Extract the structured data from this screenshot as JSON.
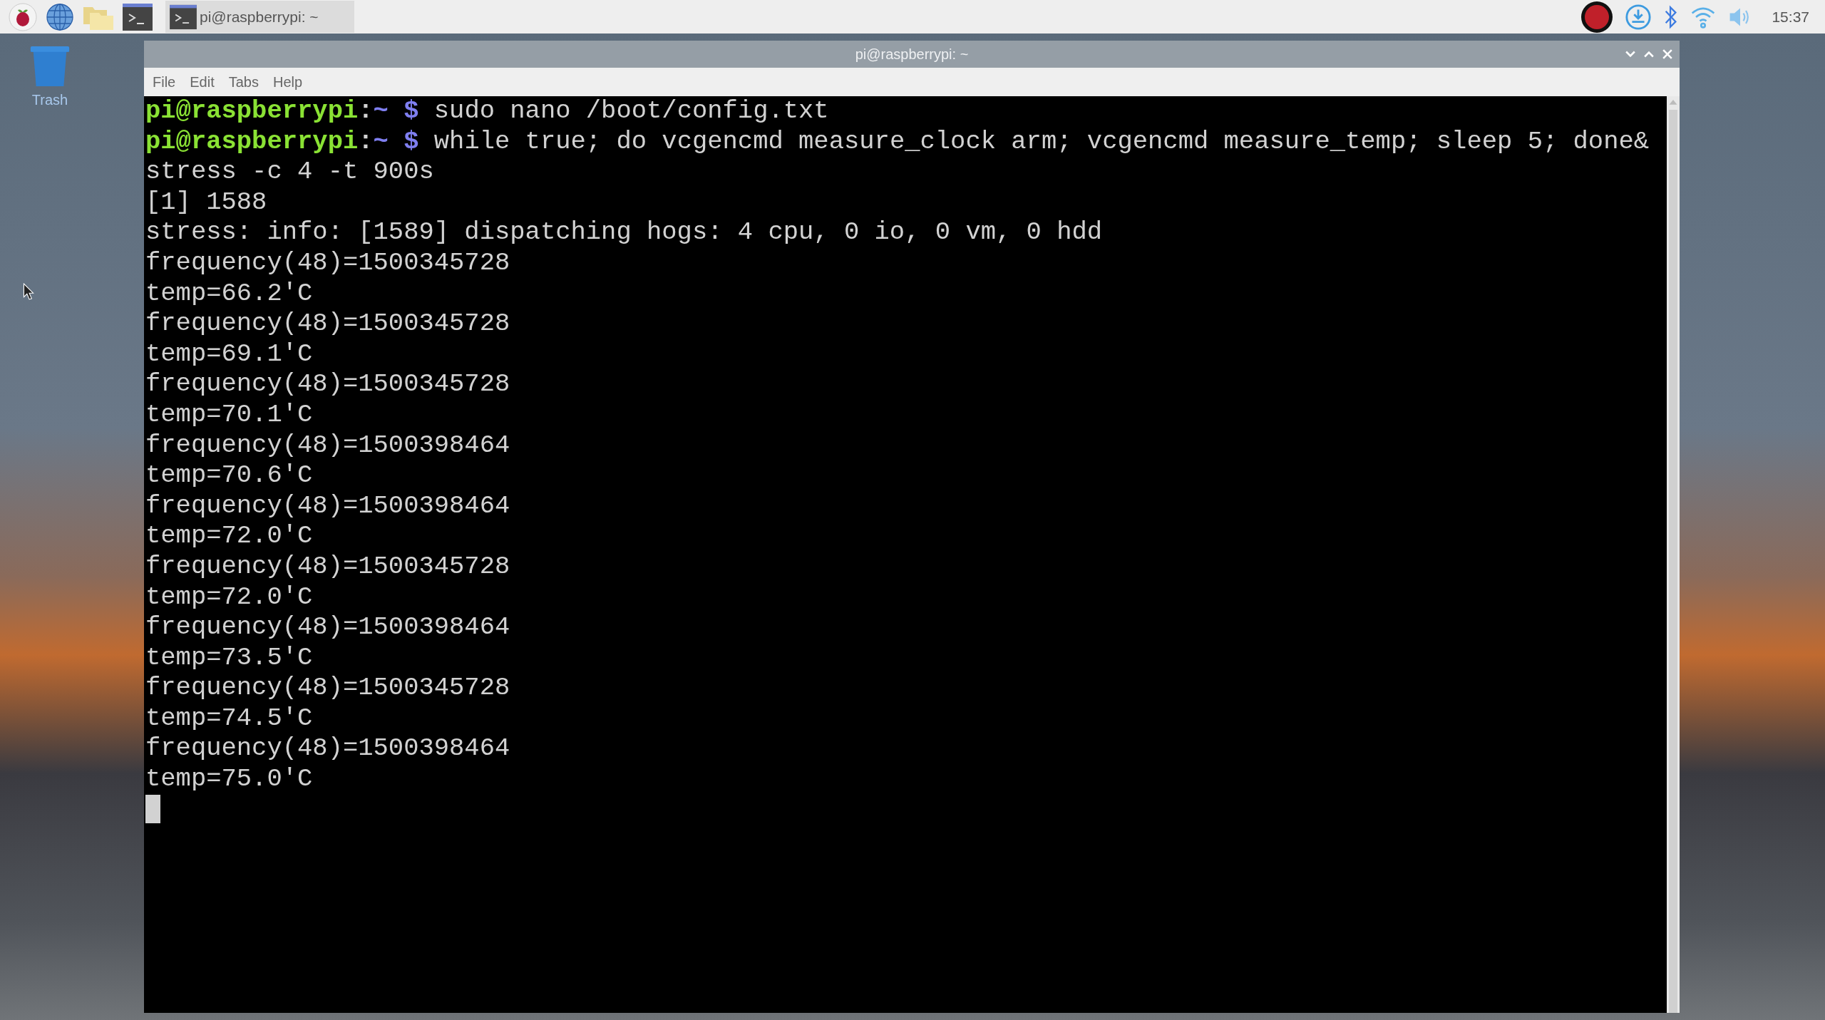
{
  "taskbar": {
    "task_button": {
      "title": "pi@raspberrypi: ~"
    },
    "clock": "15:37"
  },
  "desktop": {
    "icons": [
      {
        "label": "Trash"
      }
    ]
  },
  "window": {
    "title": "pi@raspberrypi: ~",
    "menu": [
      "File",
      "Edit",
      "Tabs",
      "Help"
    ],
    "terminal": {
      "lines": [
        {
          "kind": "prompt",
          "user_host": "pi@raspberrypi",
          "separator": ":",
          "path": "~",
          "symbol": "$",
          "command": "sudo nano /boot/config.txt"
        },
        {
          "kind": "prompt",
          "user_host": "pi@raspberrypi",
          "separator": ":",
          "path": "~",
          "symbol": "$",
          "command": "while true; do vcgencmd measure_clock arm; vcgencmd measure_temp; sleep 5; done&"
        },
        {
          "kind": "output",
          "text": "stress -c 4 -t 900s"
        },
        {
          "kind": "output",
          "text": "[1] 1588"
        },
        {
          "kind": "output",
          "text": "stress: info: [1589] dispatching hogs: 4 cpu, 0 io, 0 vm, 0 hdd"
        },
        {
          "kind": "output",
          "text": "frequency(48)=1500345728"
        },
        {
          "kind": "output",
          "text": "temp=66.2'C"
        },
        {
          "kind": "output",
          "text": "frequency(48)=1500345728"
        },
        {
          "kind": "output",
          "text": "temp=69.1'C"
        },
        {
          "kind": "output",
          "text": "frequency(48)=1500345728"
        },
        {
          "kind": "output",
          "text": "temp=70.1'C"
        },
        {
          "kind": "output",
          "text": "frequency(48)=1500398464"
        },
        {
          "kind": "output",
          "text": "temp=70.6'C"
        },
        {
          "kind": "output",
          "text": "frequency(48)=1500398464"
        },
        {
          "kind": "output",
          "text": "temp=72.0'C"
        },
        {
          "kind": "output",
          "text": "frequency(48)=1500345728"
        },
        {
          "kind": "output",
          "text": "temp=72.0'C"
        },
        {
          "kind": "output",
          "text": "frequency(48)=1500398464"
        },
        {
          "kind": "output",
          "text": "temp=73.5'C"
        },
        {
          "kind": "output",
          "text": "frequency(48)=1500345728"
        },
        {
          "kind": "output",
          "text": "temp=74.5'C"
        },
        {
          "kind": "output",
          "text": "frequency(48)=1500398464"
        },
        {
          "kind": "output",
          "text": "temp=75.0'C"
        },
        {
          "kind": "cursor"
        }
      ]
    }
  }
}
